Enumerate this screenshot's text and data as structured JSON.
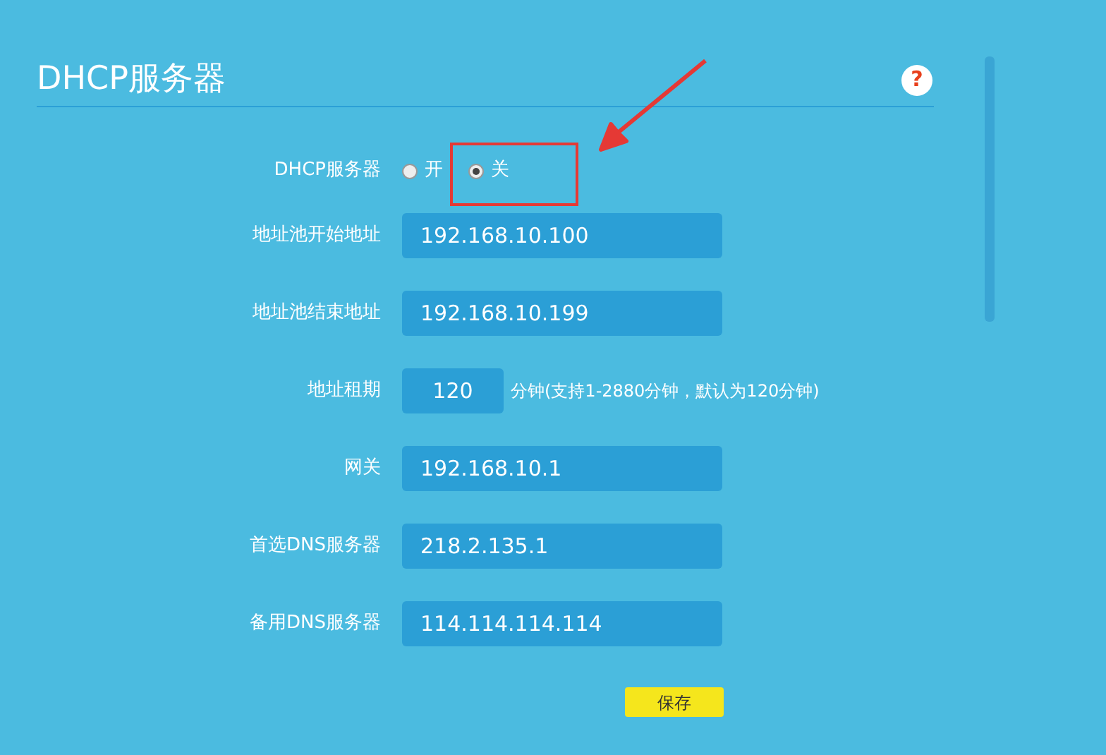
{
  "title": "DHCP服务器",
  "help": {
    "label": "?"
  },
  "fields": [
    {
      "kind": "radio",
      "label": "DHCP服务器",
      "options": [
        {
          "label": "开",
          "selected": false
        },
        {
          "label": "关",
          "selected": true
        }
      ]
    },
    {
      "kind": "text",
      "label": "地址池开始地址",
      "value": "192.168.10.100"
    },
    {
      "kind": "text",
      "label": "地址池结束地址",
      "value": "192.168.10.199"
    },
    {
      "kind": "short",
      "label": "地址租期",
      "value": "120",
      "suffix": "分钟(支持1-2880分钟，默认为120分钟)"
    },
    {
      "kind": "text",
      "label": "网关",
      "value": "192.168.10.1"
    },
    {
      "kind": "text",
      "label": "首选DNS服务器",
      "value": "218.2.135.1"
    },
    {
      "kind": "text",
      "label": "备用DNS服务器",
      "value": "114.114.114.114"
    }
  ],
  "save_button": "保存"
}
